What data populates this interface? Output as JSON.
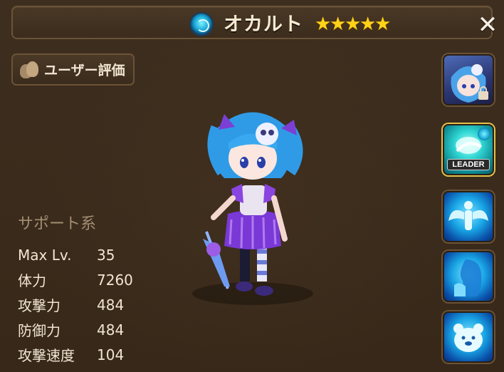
{
  "header": {
    "title": "オカルト",
    "stars": [
      "★",
      "★",
      "★",
      "★",
      "★"
    ],
    "close_label": "✕",
    "element": "dark-swirl-icon"
  },
  "rating": {
    "label": "ユーザー評価"
  },
  "stats": {
    "type_label": "サポート系",
    "rows": [
      {
        "name": "Max Lv.",
        "value": "35"
      },
      {
        "name": "体力",
        "value": "7260"
      },
      {
        "name": "攻撃力",
        "value": "484"
      },
      {
        "name": "防御力",
        "value": "484"
      },
      {
        "name": "攻撃速度",
        "value": "104"
      }
    ]
  },
  "side": {
    "leader_label": "LEADER"
  },
  "colors": {
    "background": "#3a2b1c",
    "border": "#6b5336",
    "star": "#ffd21a",
    "skill_blue": "#19a5e5"
  }
}
